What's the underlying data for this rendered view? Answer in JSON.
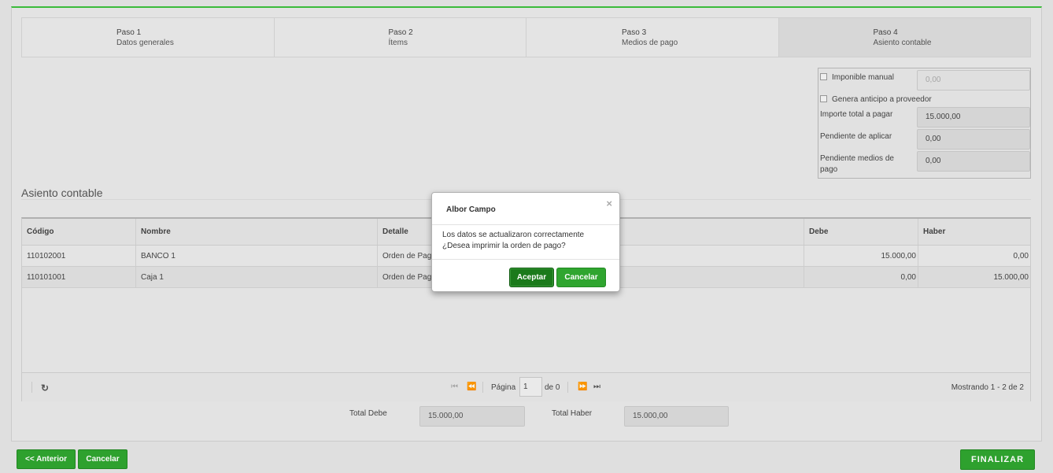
{
  "steps": [
    {
      "title": "Paso 1",
      "subtitle": "Datos generales"
    },
    {
      "title": "Paso 2",
      "subtitle": "Ítems"
    },
    {
      "title": "Paso 3",
      "subtitle": "Medios de pago"
    },
    {
      "title": "Paso 4",
      "subtitle": "Asiento contable"
    }
  ],
  "summary": {
    "imponible_label": "Imponible manual",
    "imponible_value": "0,00",
    "anticipo_label": "Genera anticipo a proveedor",
    "importe_label": "Importe total a pagar",
    "importe_value": "15.000,00",
    "pendiente_aplicar_label": "Pendiente de aplicar",
    "pendiente_aplicar_value": "0,00",
    "pendiente_medios_label_1": "Pendiente medios de",
    "pendiente_medios_label_2": "pago",
    "pendiente_medios_value": "0,00"
  },
  "section_title": "Asiento contable",
  "table": {
    "headers": {
      "codigo": "Código",
      "nombre": "Nombre",
      "detalle": "Detalle",
      "debe": "Debe",
      "haber": "Haber"
    },
    "rows": [
      {
        "codigo": "110102001",
        "nombre": "BANCO 1",
        "detalle": "Orden de Pago",
        "debe": "15.000,00",
        "haber": "0,00"
      },
      {
        "codigo": "110101001",
        "nombre": "Caja 1",
        "detalle": "Orden de Pago",
        "debe": "0,00",
        "haber": "15.000,00"
      }
    ]
  },
  "pager": {
    "page_label": "Página",
    "page_value": "1",
    "of_label": "de 0",
    "info": "Mostrando 1 - 2 de 2"
  },
  "totals": {
    "debe_label": "Total Debe",
    "debe_value": "15.000,00",
    "haber_label": "Total Haber",
    "haber_value": "15.000,00"
  },
  "footer": {
    "prev_label": "<< Anterior",
    "cancel_label": "Cancelar",
    "finish_label": "FINALIZAR"
  },
  "modal": {
    "title": "Albor Campo",
    "close": "×",
    "line1": "Los datos se actualizaron correctamente",
    "line2": "¿Desea imprimir la orden de pago?",
    "accept_label": "Aceptar",
    "cancel_label": "Cancelar"
  },
  "colors": {
    "accent_green": "#2fa52f",
    "accept_green": "#1b7a1b"
  }
}
